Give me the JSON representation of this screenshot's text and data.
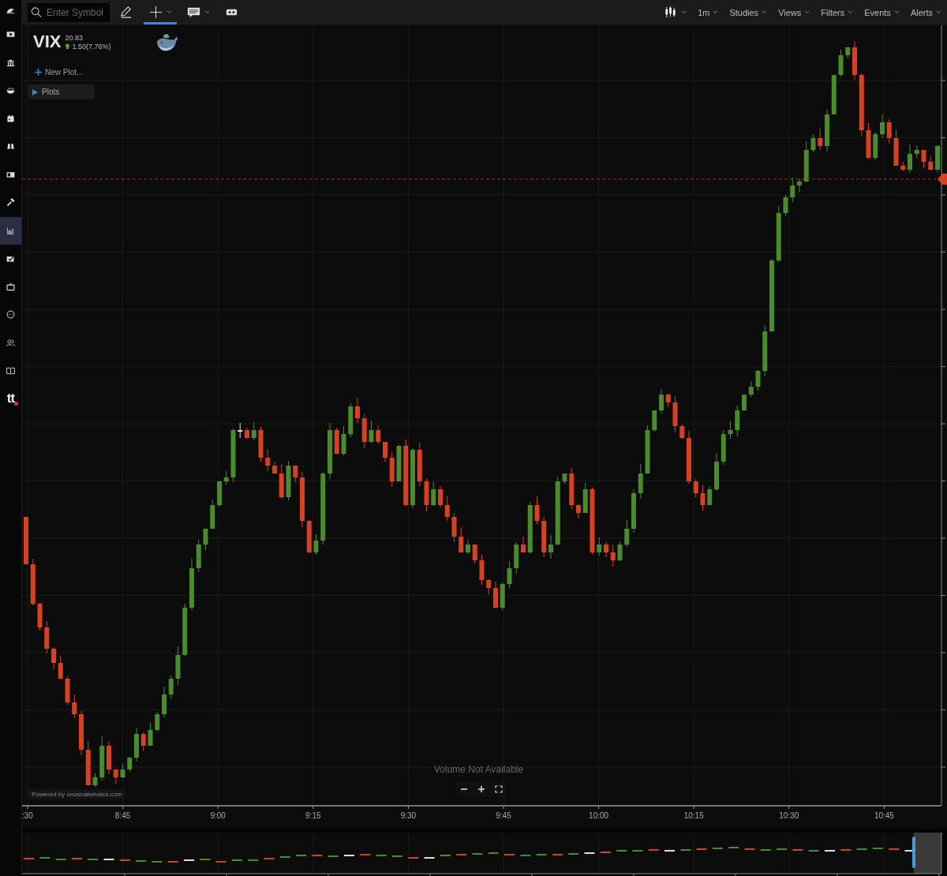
{
  "sidebar": {
    "items": [
      {
        "kind": "logo",
        "selected": false
      },
      {
        "kind": "money",
        "selected": false
      },
      {
        "kind": "bank",
        "selected": false
      },
      {
        "kind": "bowl",
        "selected": false
      },
      {
        "kind": "calendar",
        "selected": false
      },
      {
        "kind": "binoculars",
        "selected": false
      },
      {
        "kind": "news",
        "selected": false
      },
      {
        "kind": "hammer",
        "selected": false
      },
      {
        "kind": "chart",
        "selected": true
      },
      {
        "kind": "checkbox",
        "selected": false
      },
      {
        "kind": "tv",
        "selected": false
      },
      {
        "kind": "chat",
        "selected": false
      },
      {
        "kind": "users",
        "selected": false
      },
      {
        "kind": "book",
        "selected": false
      },
      {
        "kind": "text",
        "label": "tt",
        "selected": false
      }
    ]
  },
  "toolbar": {
    "search": {
      "placeholder": "Enter Symbol"
    },
    "tools": [
      {
        "kind": "pencil",
        "selected": false,
        "dropdown": false
      },
      {
        "kind": "crosshair",
        "selected": true,
        "dropdown": true
      },
      {
        "kind": "note",
        "selected": false,
        "dropdown": true
      },
      {
        "kind": "mask",
        "selected": false,
        "dropdown": false
      }
    ],
    "chart_style": {
      "kind": "candles",
      "dropdown": true
    },
    "menus": [
      {
        "label": "1m"
      },
      {
        "label": "Studies"
      },
      {
        "label": "Views"
      },
      {
        "label": "Filters"
      },
      {
        "label": "Events"
      },
      {
        "label": "Alerts"
      }
    ]
  },
  "legend": {
    "symbol": "VIX",
    "price": "20.83",
    "rising": true,
    "change": "1.50(7.76%)",
    "new_plot": "New Plot...",
    "plots": {
      "label": "Plots",
      "expanded": false
    }
  },
  "chart": {
    "volume_message": "Volume Not Available",
    "credit": "Powered by unusualwhales.com",
    "time_labels": [
      ":30",
      "8:45",
      "9:00",
      "9:15",
      "9:30",
      "9:45",
      "10:00",
      "10:15",
      "10:30",
      "10:45"
    ]
  }
}
